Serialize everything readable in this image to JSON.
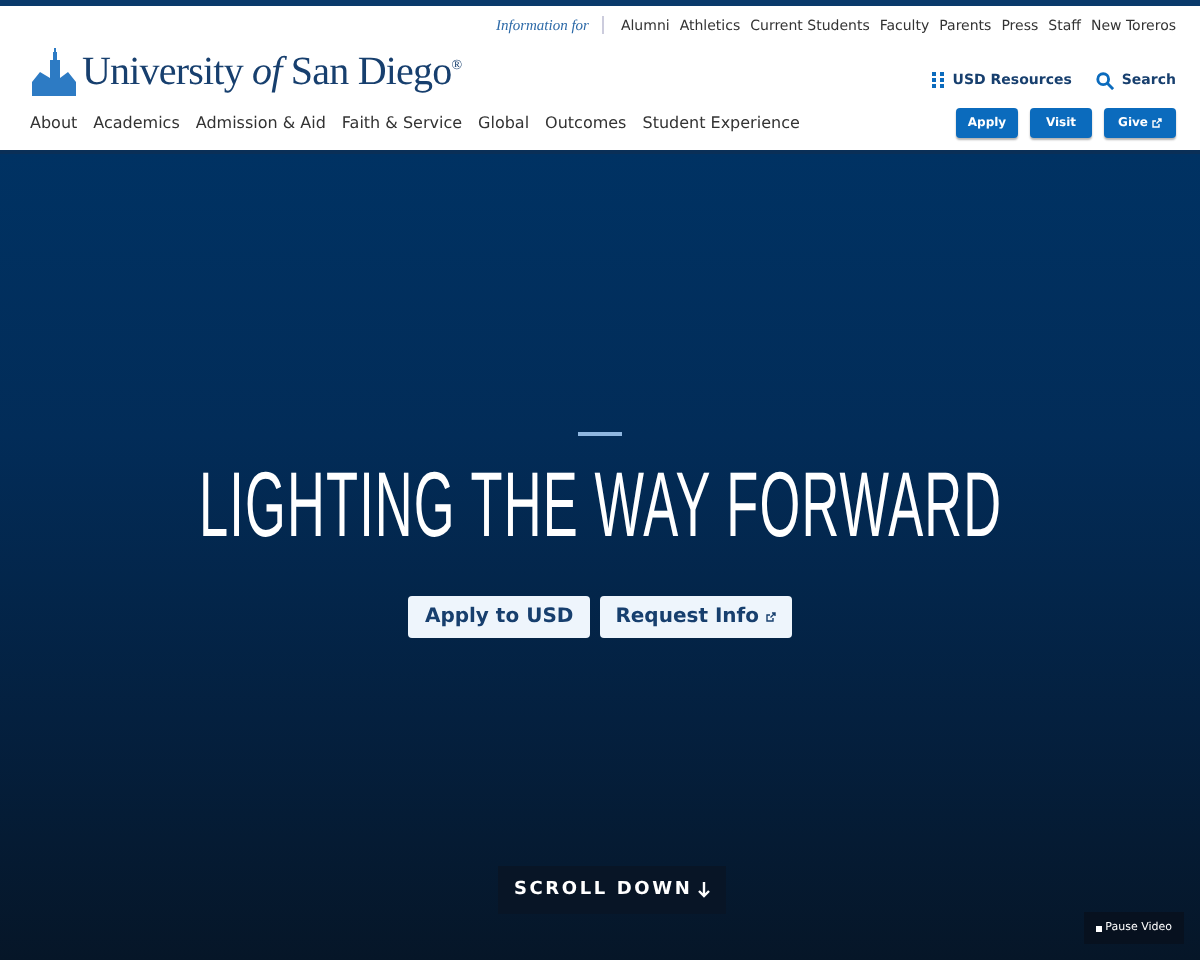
{
  "utility_nav": {
    "label": "Information for",
    "links": [
      "Alumni",
      "Athletics",
      "Current Students",
      "Faculty",
      "Parents",
      "Press",
      "Staff",
      "New Toreros"
    ]
  },
  "logo": {
    "text": "University *of* San Diego$^{®}$"
  },
  "header_tools": [
    {
      "kind": "grid",
      "label": "USD Resources"
    },
    {
      "kind": "search",
      "label": "Search"
    }
  ],
  "main_nav": [
    "About",
    "Academics",
    "Admission & Aid",
    "Faith & Service",
    "Global",
    "Outcomes",
    "Student Experience"
  ],
  "header_buttons": [
    {
      "label": "Apply",
      "external": false
    },
    {
      "label": "Visit",
      "external": false
    },
    {
      "label": "Give",
      "external": true
    }
  ],
  "hero": {
    "title": "LIGHTING THE WAY FORWARD",
    "buttons": [
      {
        "label": "Apply to USD",
        "external": false
      },
      {
        "label": "Request Info",
        "external": true
      }
    ],
    "scroll": {
      "label": "SCROLL DOWN"
    },
    "video_control": {
      "label": "Pause Video"
    }
  }
}
